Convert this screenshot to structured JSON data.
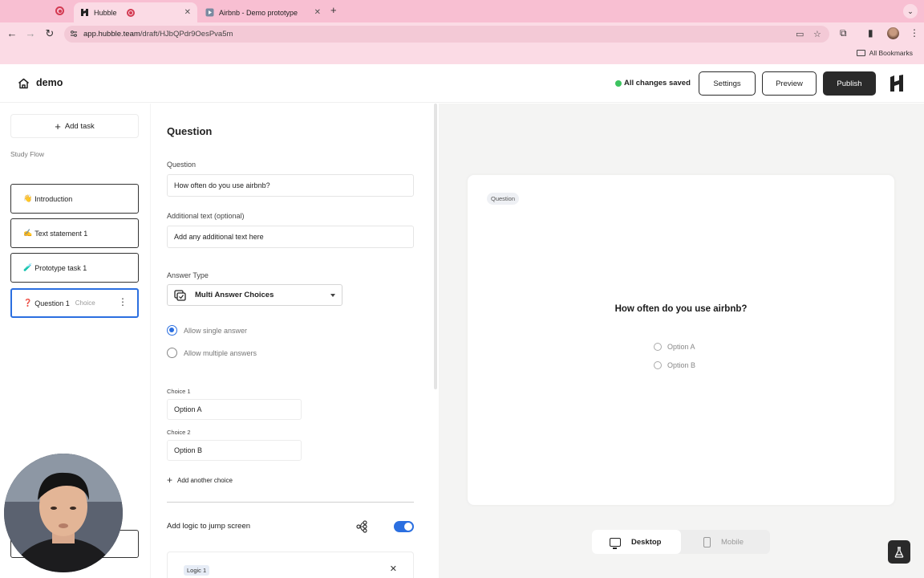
{
  "browser": {
    "tabs": [
      {
        "label": "Hubble",
        "active": true
      },
      {
        "label": "Airbnb - Demo prototype",
        "active": false
      }
    ],
    "url_host": "app.hubble.team",
    "url_path": "/draft/HJbQPdr9OesPva5m",
    "all_bookmarks": "All Bookmarks",
    "colors": {
      "tab_strip": "#f8bfd2",
      "toolbar": "#fbdbe5"
    }
  },
  "header": {
    "project_name": "demo",
    "save_status": "All changes saved",
    "settings_label": "Settings",
    "preview_label": "Preview",
    "publish_label": "Publish"
  },
  "sidebar": {
    "add_task_label": "Add task",
    "section_label": "Study Flow",
    "items": [
      {
        "emoji": "👋",
        "label": "Introduction",
        "sub": ""
      },
      {
        "emoji": "✍️",
        "label": "Text statement 1",
        "sub": ""
      },
      {
        "emoji": "🧪",
        "label": "Prototype task 1",
        "sub": ""
      },
      {
        "emoji": "❓",
        "label": "Question 1",
        "sub": "Choice"
      }
    ]
  },
  "editor": {
    "title": "Question",
    "question_label": "Question",
    "question_value": "How often do you use airbnb?",
    "additional_label": "Additional text (optional)",
    "additional_placeholder": "Add any additional text here",
    "answer_type_label": "Answer Type",
    "answer_type_value": "Multi Answer Choices",
    "radio_single": "Allow single answer",
    "radio_multiple": "Allow multiple answers",
    "choices": [
      {
        "label": "Choice 1",
        "value": "Option A"
      },
      {
        "label": "Choice 2",
        "value": "Option B"
      }
    ],
    "add_choice_label": "Add another choice",
    "logic_label": "Add logic to jump screen",
    "logic_badge": "Logic 1"
  },
  "preview": {
    "badge": "Question",
    "question": "How often do you use airbnb?",
    "options": [
      "Option A",
      "Option B"
    ],
    "desktop_label": "Desktop",
    "mobile_label": "Mobile"
  },
  "colors": {
    "accent": "#2b6fe0",
    "dark": "#2a2a2a",
    "saved_dot": "#3cc35f"
  }
}
